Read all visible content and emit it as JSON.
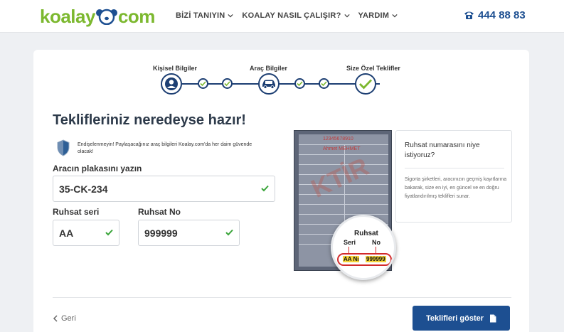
{
  "header": {
    "logo_parts": [
      "koalay",
      "com"
    ],
    "nav": [
      {
        "label": "BİZİ TANIYIN"
      },
      {
        "label": "KOALAY NASIL ÇALIŞIR?"
      },
      {
        "label": "YARDIM"
      }
    ],
    "phone": "444 88 83"
  },
  "stepper": {
    "steps": [
      {
        "label": "Kişisel Bilgiler",
        "icon": "user-icon"
      },
      {
        "label": "Araç Bilgiler",
        "icon": "car-icon"
      },
      {
        "label": "Size Özel Teklifler",
        "icon": "check-icon"
      }
    ]
  },
  "main": {
    "title": "Teklifleriniz neredeyse hazır!",
    "notice": "Endişelenmeyin! Paylaşacağınız araç bilgileri Koalay.com'da her daim güvende olacak!",
    "plate": {
      "label": "Aracın plakasını yazın",
      "value": "35-CK-234"
    },
    "series": {
      "label": "Ruhsat seri",
      "value": "AA"
    },
    "number": {
      "label": "Ruhsat No",
      "value": "999999"
    }
  },
  "document": {
    "red_number": "12345678910",
    "red_name": "Ahmet MEHMET",
    "watermark": "KTİR",
    "mag_title": "Ruhsat",
    "mag_seri": "Seri",
    "mag_no": "No",
    "mag_series_value": "AA Nı",
    "mag_number_value": "999999"
  },
  "info": {
    "title": "Ruhsat numarasını niye istiyoruz?",
    "body": "Sigorta şirketleri, aracınızın geçmiş kayıtlarına bakarak, size en iyi, en güncel ve en doğru fiyatlandırılmış teklifleri sunar."
  },
  "footer": {
    "back_label": "Geri",
    "cta_label": "Teklifleri göster"
  },
  "colors": {
    "brand_green": "#7cb82f",
    "brand_blue": "#1d4f91",
    "valid_check": "#3aa53a"
  }
}
